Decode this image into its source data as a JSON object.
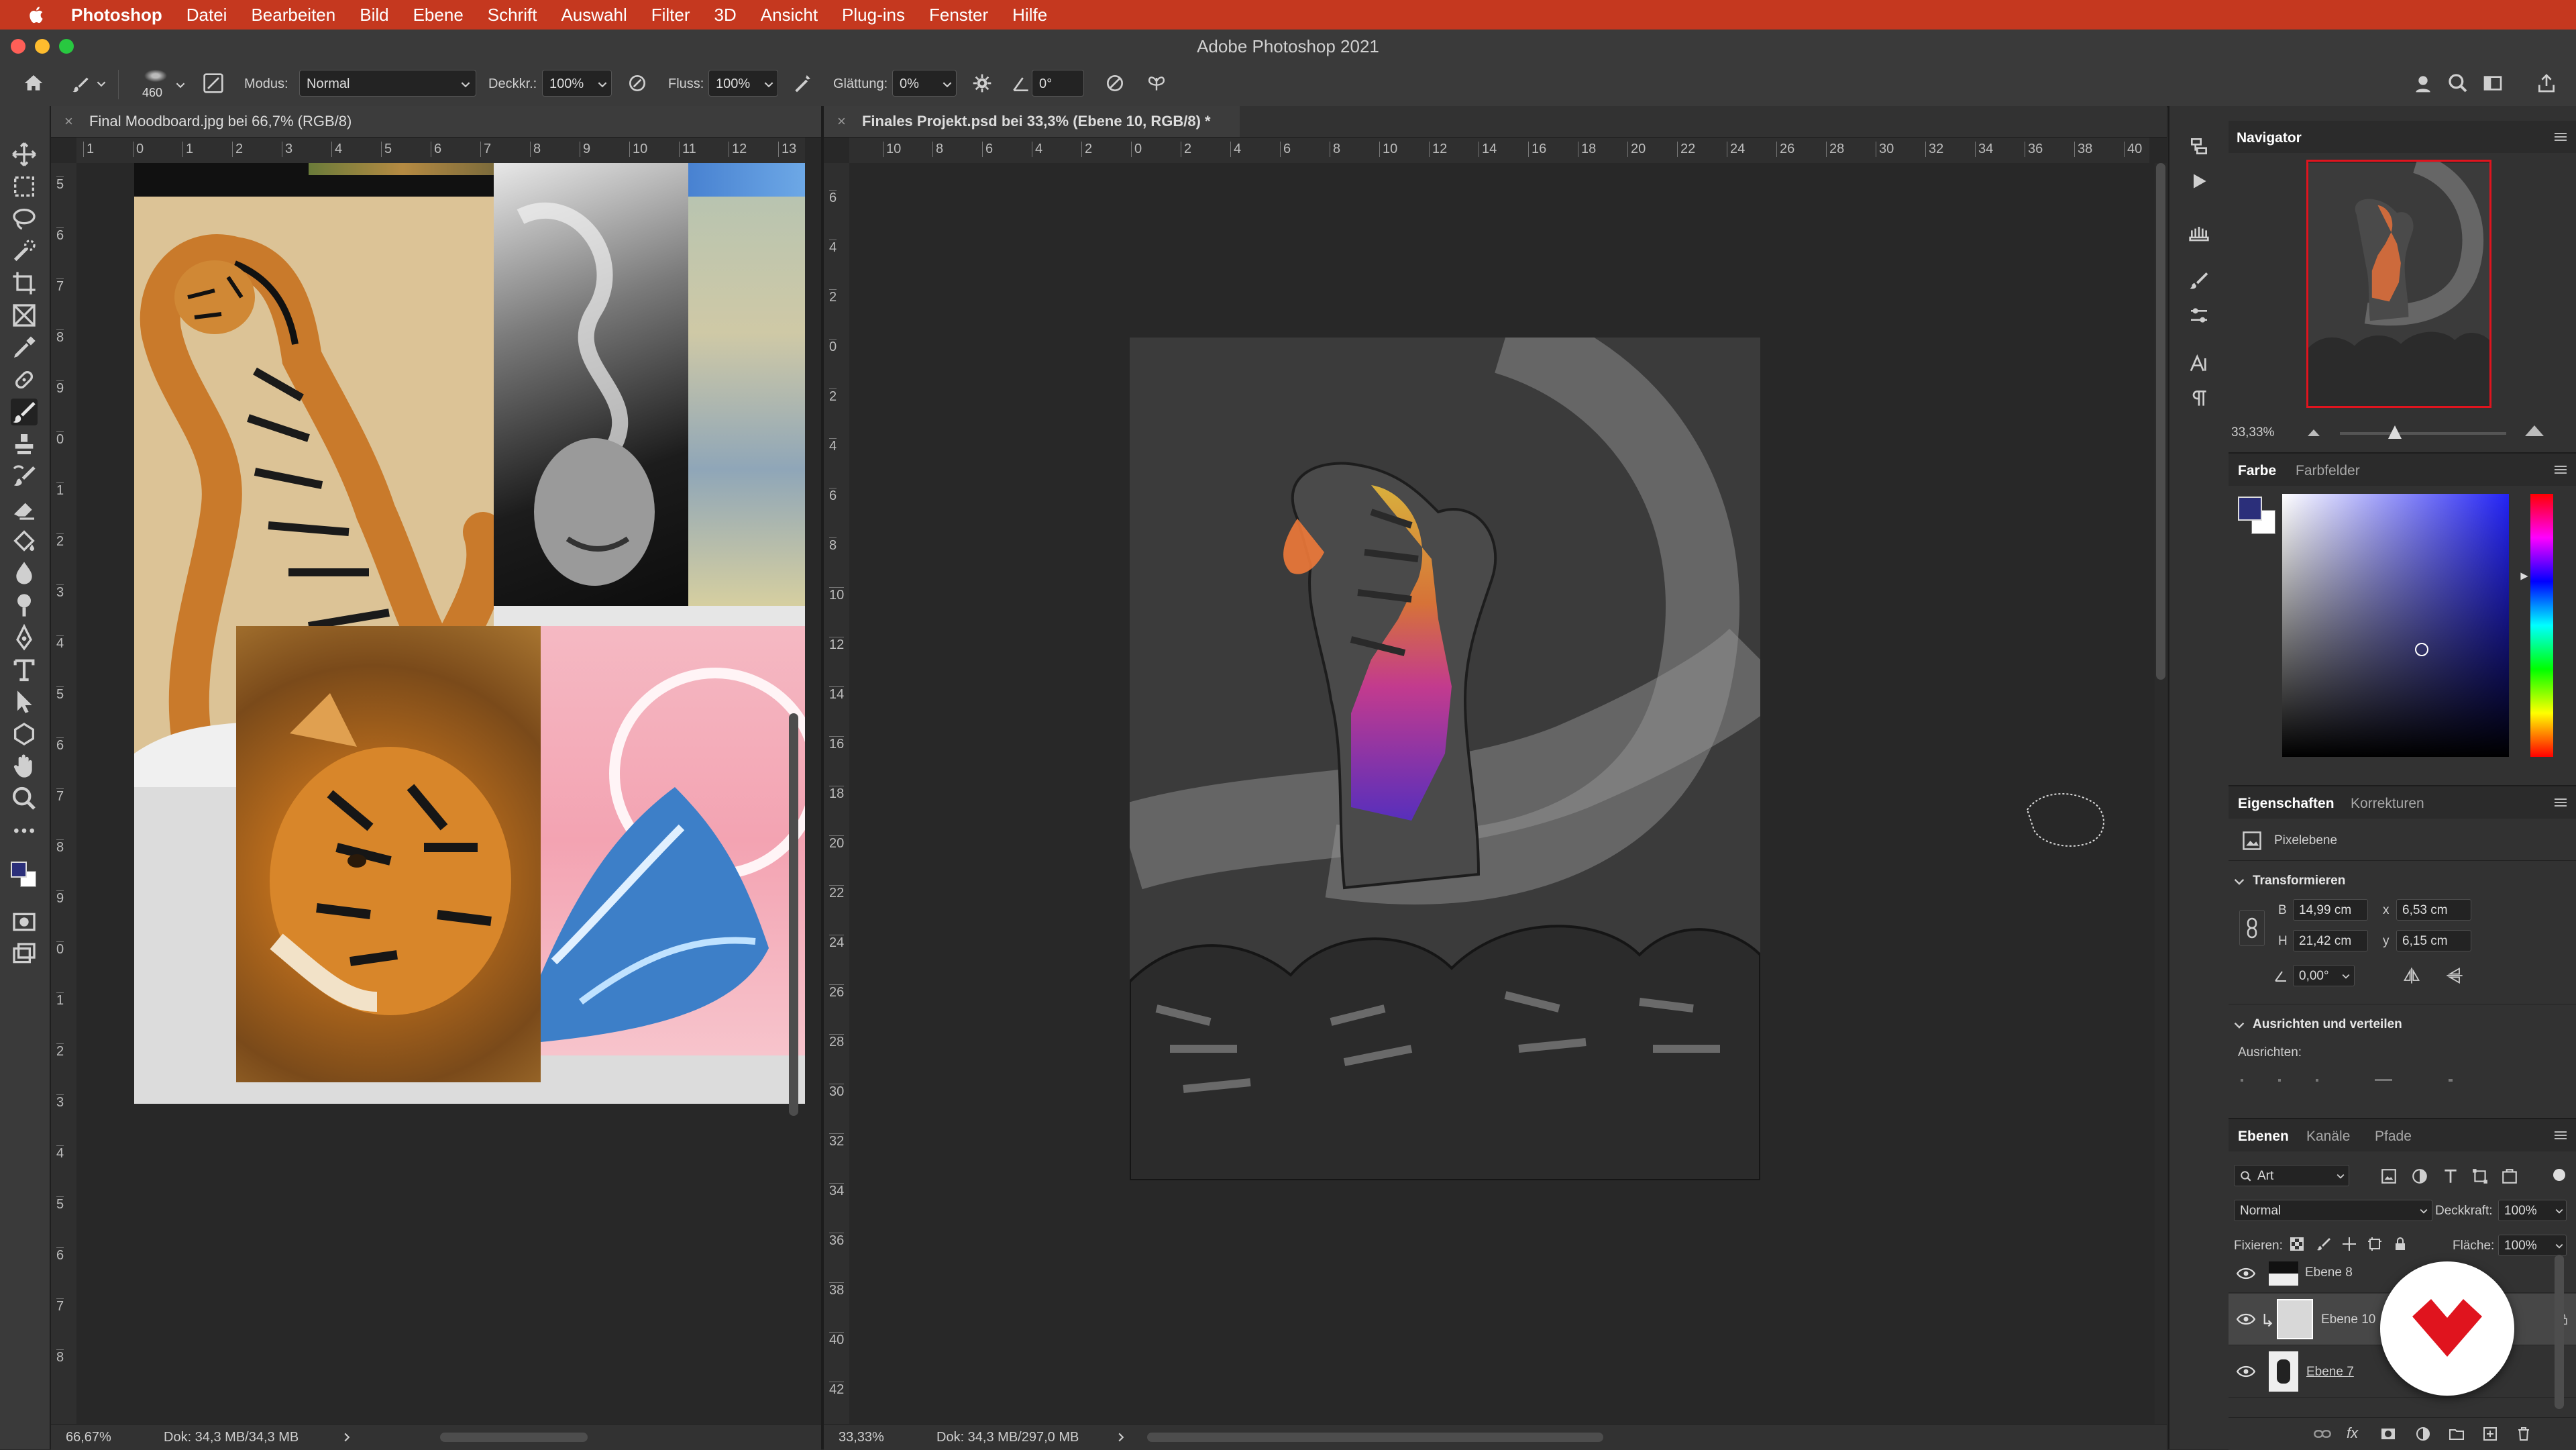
{
  "menubar": {
    "app": "Photoshop",
    "items": [
      "Datei",
      "Bearbeiten",
      "Bild",
      "Ebene",
      "Schrift",
      "Auswahl",
      "Filter",
      "3D",
      "Ansicht",
      "Plug-ins",
      "Fenster",
      "Hilfe"
    ]
  },
  "window": {
    "title": "Adobe Photoshop 2021"
  },
  "options": {
    "brush_size": "460",
    "mode_label": "Modus:",
    "mode_value": "Normal",
    "opacity_label": "Deckkr.:",
    "opacity_value": "100%",
    "flow_label": "Fluss:",
    "flow_value": "100%",
    "smoothing_label": "Glättung:",
    "smoothing_value": "0%",
    "angle_value": "0°"
  },
  "doc_left": {
    "tab": "Final Moodboard.jpg bei 66,7% (RGB/8)",
    "zoom": "66,67%",
    "doc_info": "Dok: 34,3 MB/34,3 MB",
    "hruler": [
      "1",
      "0",
      "1",
      "2",
      "3",
      "4",
      "5",
      "6",
      "7",
      "8",
      "9",
      "10",
      "11",
      "12",
      "13"
    ],
    "vruler": [
      "5",
      "6",
      "7",
      "8",
      "9",
      "0",
      "1",
      "2",
      "3",
      "4",
      "5",
      "6",
      "7",
      "8",
      "9",
      "0",
      "1",
      "2",
      "3",
      "4",
      "5",
      "6",
      "7",
      "8"
    ]
  },
  "doc_right": {
    "tab": "Finales Projekt.psd bei 33,3% (Ebene 10, RGB/8) *",
    "zoom": "33,33%",
    "doc_info": "Dok: 34,3 MB/297,0 MB",
    "hruler": [
      "10",
      "8",
      "6",
      "4",
      "2",
      "0",
      "2",
      "4",
      "6",
      "8",
      "10",
      "12",
      "14",
      "16",
      "18",
      "20",
      "22",
      "24",
      "26",
      "28",
      "30",
      "32",
      "34",
      "36",
      "38",
      "40"
    ],
    "vruler": [
      "6",
      "4",
      "2",
      "0",
      "2",
      "4",
      "6",
      "8",
      "10",
      "12",
      "14",
      "16",
      "18",
      "20",
      "22",
      "24",
      "26",
      "28",
      "30",
      "32",
      "34",
      "36",
      "38",
      "40",
      "42"
    ]
  },
  "navigator": {
    "title": "Navigator",
    "zoom": "33,33%",
    "zoom_level": 0.33
  },
  "color": {
    "tab_active": "Farbe",
    "tab_inactive": "Farbfelder",
    "foreground": "#2b2f7a",
    "background": "#ffffff"
  },
  "properties": {
    "tab_active": "Eigenschaften",
    "tab_inactive": "Korrekturen",
    "kind": "Pixelebene",
    "transform_title": "Transformieren",
    "w_label": "B",
    "w_value": "14,99 cm",
    "x_label": "x",
    "x_value": "6,53 cm",
    "h_label": "H",
    "h_value": "21,42 cm",
    "y_label": "y",
    "y_value": "6,15 cm",
    "angle_value": "0,00°",
    "align_title": "Ausrichten und verteilen",
    "align_label": "Ausrichten:"
  },
  "layers": {
    "tabs": [
      "Ebenen",
      "Kanäle",
      "Pfade"
    ],
    "filter": "Art",
    "blend_mode": "Normal",
    "opacity_label": "Deckkraft:",
    "opacity_value": "100%",
    "lock_label": "Fixieren:",
    "fill_label": "Fläche:",
    "fill_value": "100%",
    "rows": [
      {
        "name": "Ebene 8"
      },
      {
        "name": "Ebene 10"
      },
      {
        "name": "Ebene 7"
      }
    ]
  },
  "colors": {
    "menubar": "#c5381f",
    "panel": "#323232",
    "accent": "#e0141e"
  }
}
